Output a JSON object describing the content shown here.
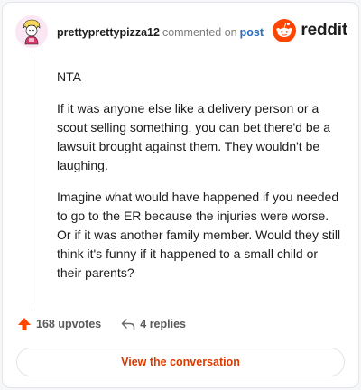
{
  "comment": {
    "username": "prettyprettypizza12",
    "action_text": "commented on",
    "post_link": "post",
    "paragraphs": [
      "NTA",
      "If it was anyone else like a delivery person or a scout selling something, you can bet there'd be a lawsuit brought against them. They wouldn't be laughing.",
      "Imagine what would have happened if you needed to go to the ER because the injuries were worse. Or if it was another family member. Would they still think it's funny if it happened to a small child or their parents?"
    ]
  },
  "brand": {
    "name": "reddit",
    "icon": "reddit-snoo-icon",
    "color": "#ff4500"
  },
  "stats": {
    "upvotes": "168 upvotes",
    "upvote_icon": "upvote-arrow-icon",
    "upvote_color": "#ff4500",
    "replies": "4 replies",
    "reply_icon": "reply-arrow-icon"
  },
  "cta": {
    "label": "View the conversation",
    "color": "#d93a00"
  }
}
